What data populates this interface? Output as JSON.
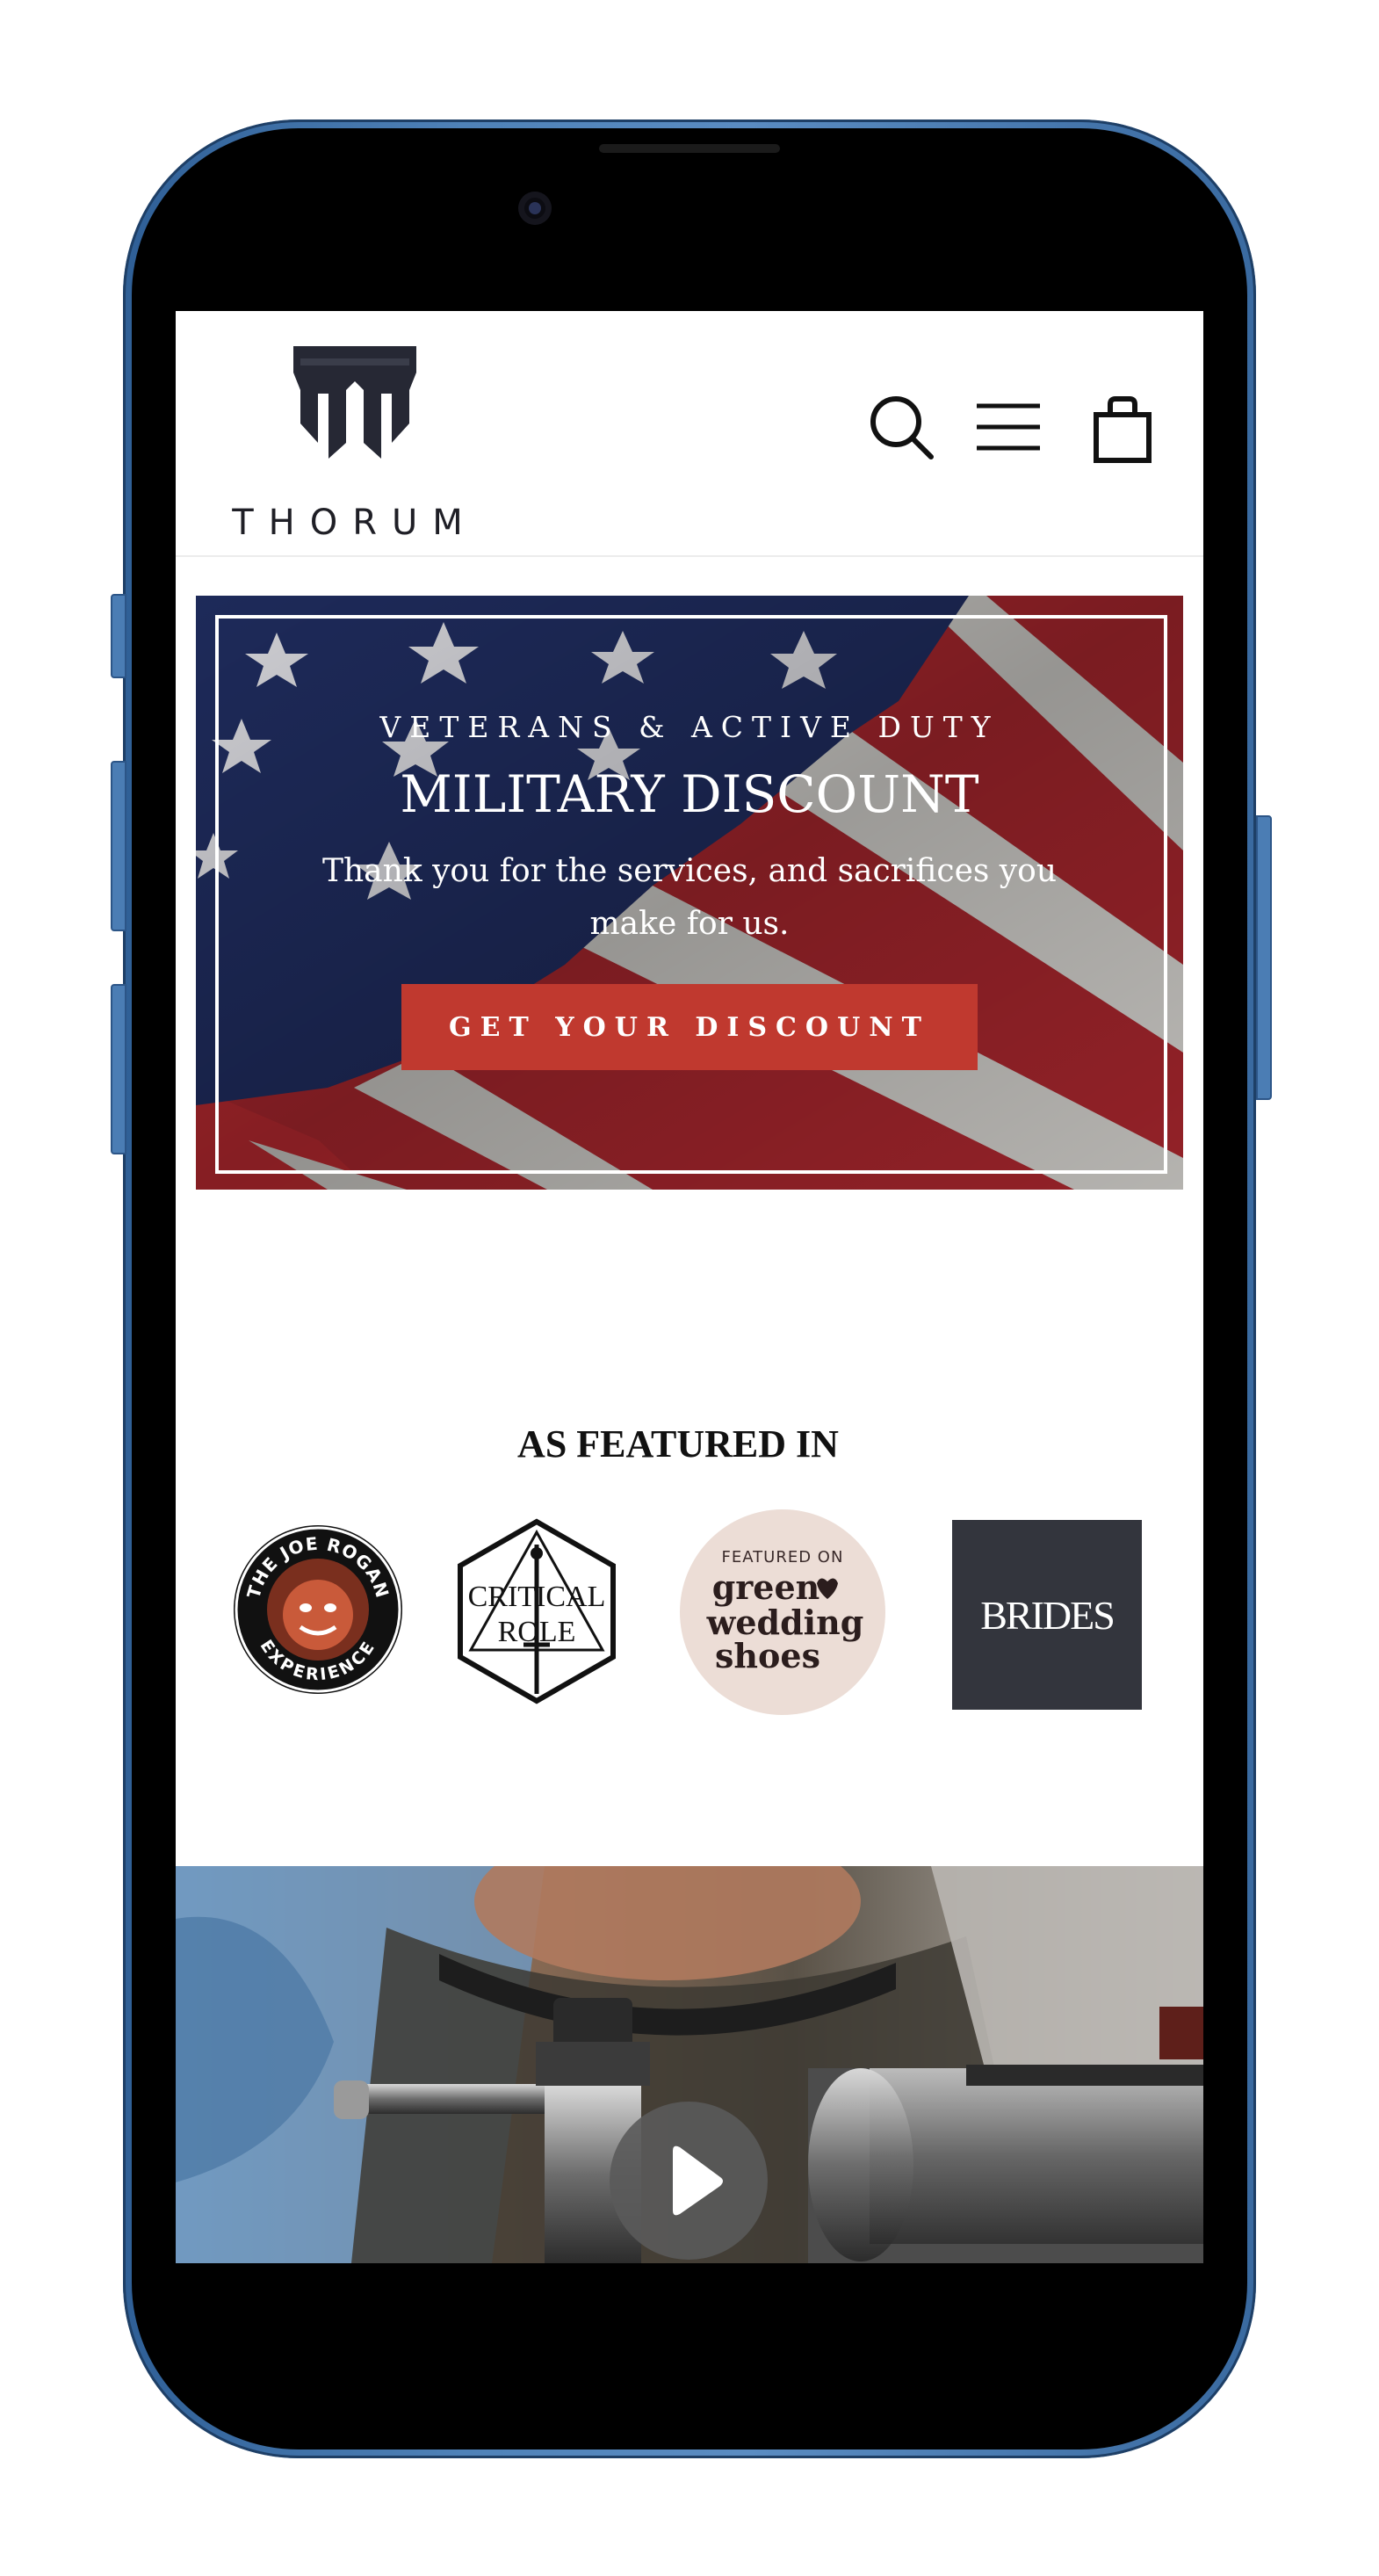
{
  "header": {
    "logo_text": "THORUM",
    "icons": [
      "search-icon",
      "menu-icon",
      "cart-icon"
    ]
  },
  "hero": {
    "kicker": "VETERANS & ACTIVE DUTY",
    "title": "MILITARY DISCOUNT",
    "subtitle": "Thank you for the services, and sacrifices you make for us.",
    "button_label": "GET YOUR DISCOUNT",
    "button_color": "#c0392f"
  },
  "featured": {
    "title": "AS FEATURED IN",
    "logos": [
      {
        "name": "The Joe Rogan Experience",
        "text_top": "THE JOE ROGAN",
        "text_bottom": "EXPERIENCE"
      },
      {
        "name": "Critical Role",
        "line1": "CRITICAL",
        "line2": "ROLE"
      },
      {
        "name": "Green Wedding Shoes",
        "small": "FEATURED ON",
        "line1": "green",
        "line2": "wedding",
        "line3": "shoes"
      },
      {
        "name": "Brides",
        "text": "BRIDES"
      }
    ]
  },
  "video": {
    "play_icon": "play-icon"
  },
  "colors": {
    "accent": "#c0392f",
    "phone_frame": "#4f82b8",
    "brides_bg": "#33353d",
    "gws_bg": "#ecddd6"
  }
}
